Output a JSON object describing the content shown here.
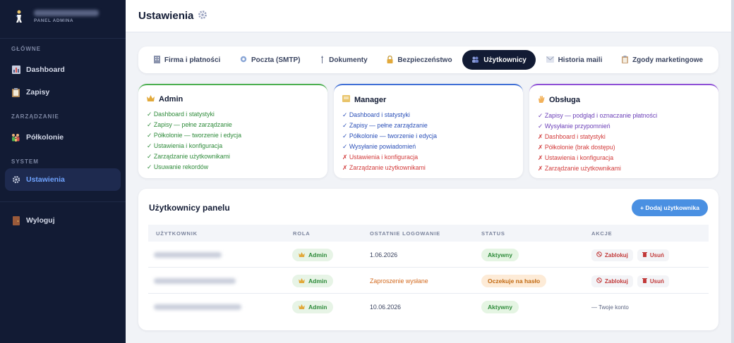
{
  "sidebar": {
    "brand_sub": "PANEL ADMINA",
    "sections": [
      {
        "title": "GŁÓWNE",
        "items": [
          {
            "label": "Dashboard",
            "icon": "chart-icon"
          },
          {
            "label": "Zapisy",
            "icon": "clipboard-icon"
          }
        ]
      },
      {
        "title": "ZARZĄDZANIE",
        "items": [
          {
            "label": "Półkolonie",
            "icon": "family-icon"
          }
        ]
      },
      {
        "title": "SYSTEM",
        "items": [
          {
            "label": "Ustawienia",
            "icon": "gear-icon",
            "active": true
          }
        ]
      }
    ],
    "logout_label": "Wyloguj"
  },
  "header": {
    "title": "Ustawienia"
  },
  "tabs": [
    {
      "label": "Firma i płatności",
      "icon": "building-icon"
    },
    {
      "label": "Poczta (SMTP)",
      "icon": "mail-icon"
    },
    {
      "label": "Dokumenty",
      "icon": "document-icon"
    },
    {
      "label": "Bezpieczeństwo",
      "icon": "lock-icon"
    },
    {
      "label": "Użytkownicy",
      "icon": "users-icon",
      "active": true
    },
    {
      "label": "Historia maili",
      "icon": "history-icon"
    },
    {
      "label": "Zgody marketingowe",
      "icon": "consent-icon"
    }
  ],
  "roles": [
    {
      "name": "Admin",
      "icon": "crown-icon",
      "color": "#4caf50",
      "lines": [
        {
          "ok": true,
          "text": "Dashboard i statystyki"
        },
        {
          "ok": true,
          "text": "Zapisy — pełne zarządzanie"
        },
        {
          "ok": true,
          "text": "Półkolonie — tworzenie i edycja"
        },
        {
          "ok": true,
          "text": "Ustawienia i konfiguracja"
        },
        {
          "ok": true,
          "text": "Zarządzanie użytkownikami"
        },
        {
          "ok": true,
          "text": "Usuwanie rekordów"
        }
      ]
    },
    {
      "name": "Manager",
      "icon": "folder-icon",
      "color": "#3f6fd6",
      "lines": [
        {
          "ok": true,
          "text": "Dashboard i statystyki"
        },
        {
          "ok": true,
          "text": "Zapisy — pełne zarządzanie"
        },
        {
          "ok": true,
          "text": "Półkolonie — tworzenie i edycja"
        },
        {
          "ok": true,
          "text": "Wysyłanie powiadomień"
        },
        {
          "ok": false,
          "text": "Ustawienia i konfiguracja"
        },
        {
          "ok": false,
          "text": "Zarządzanie użytkownikami"
        }
      ]
    },
    {
      "name": "Obsługa",
      "icon": "wave-hand-icon",
      "color": "#8e4fd6",
      "lines": [
        {
          "ok": true,
          "text": "Zapisy — podgląd i oznaczanie płatności"
        },
        {
          "ok": true,
          "text": "Wysyłanie przypomnień"
        },
        {
          "ok": false,
          "text": "Dashboard i statystyki"
        },
        {
          "ok": false,
          "text": "Półkolonie (brak dostępu)"
        },
        {
          "ok": false,
          "text": "Ustawienia i konfiguracja"
        },
        {
          "ok": false,
          "text": "Zarządzanie użytkownikami"
        }
      ]
    }
  ],
  "users": {
    "title": "Użytkownicy panelu",
    "add_label": "+ Dodaj użytkownika",
    "columns": [
      "UŻYTKOWNIK",
      "ROLA",
      "OSTATNIE LOGOWANIE",
      "STATUS",
      "AKCJE"
    ],
    "rows": [
      {
        "role": "Admin",
        "last_login": "1.06.2026",
        "status": "Aktywny",
        "status_kind": "active",
        "actions": [
          "Zablokuj",
          "Usuń"
        ]
      },
      {
        "role": "Admin",
        "last_login": "Zaproszenie wysłane",
        "status": "Oczekuje na hasło",
        "status_kind": "pending",
        "actions": [
          "Zablokuj",
          "Usuń"
        ]
      },
      {
        "role": "Admin",
        "last_login": "10.06.2026",
        "status": "Aktywny",
        "status_kind": "active",
        "note": "— Twoje konto"
      }
    ]
  }
}
